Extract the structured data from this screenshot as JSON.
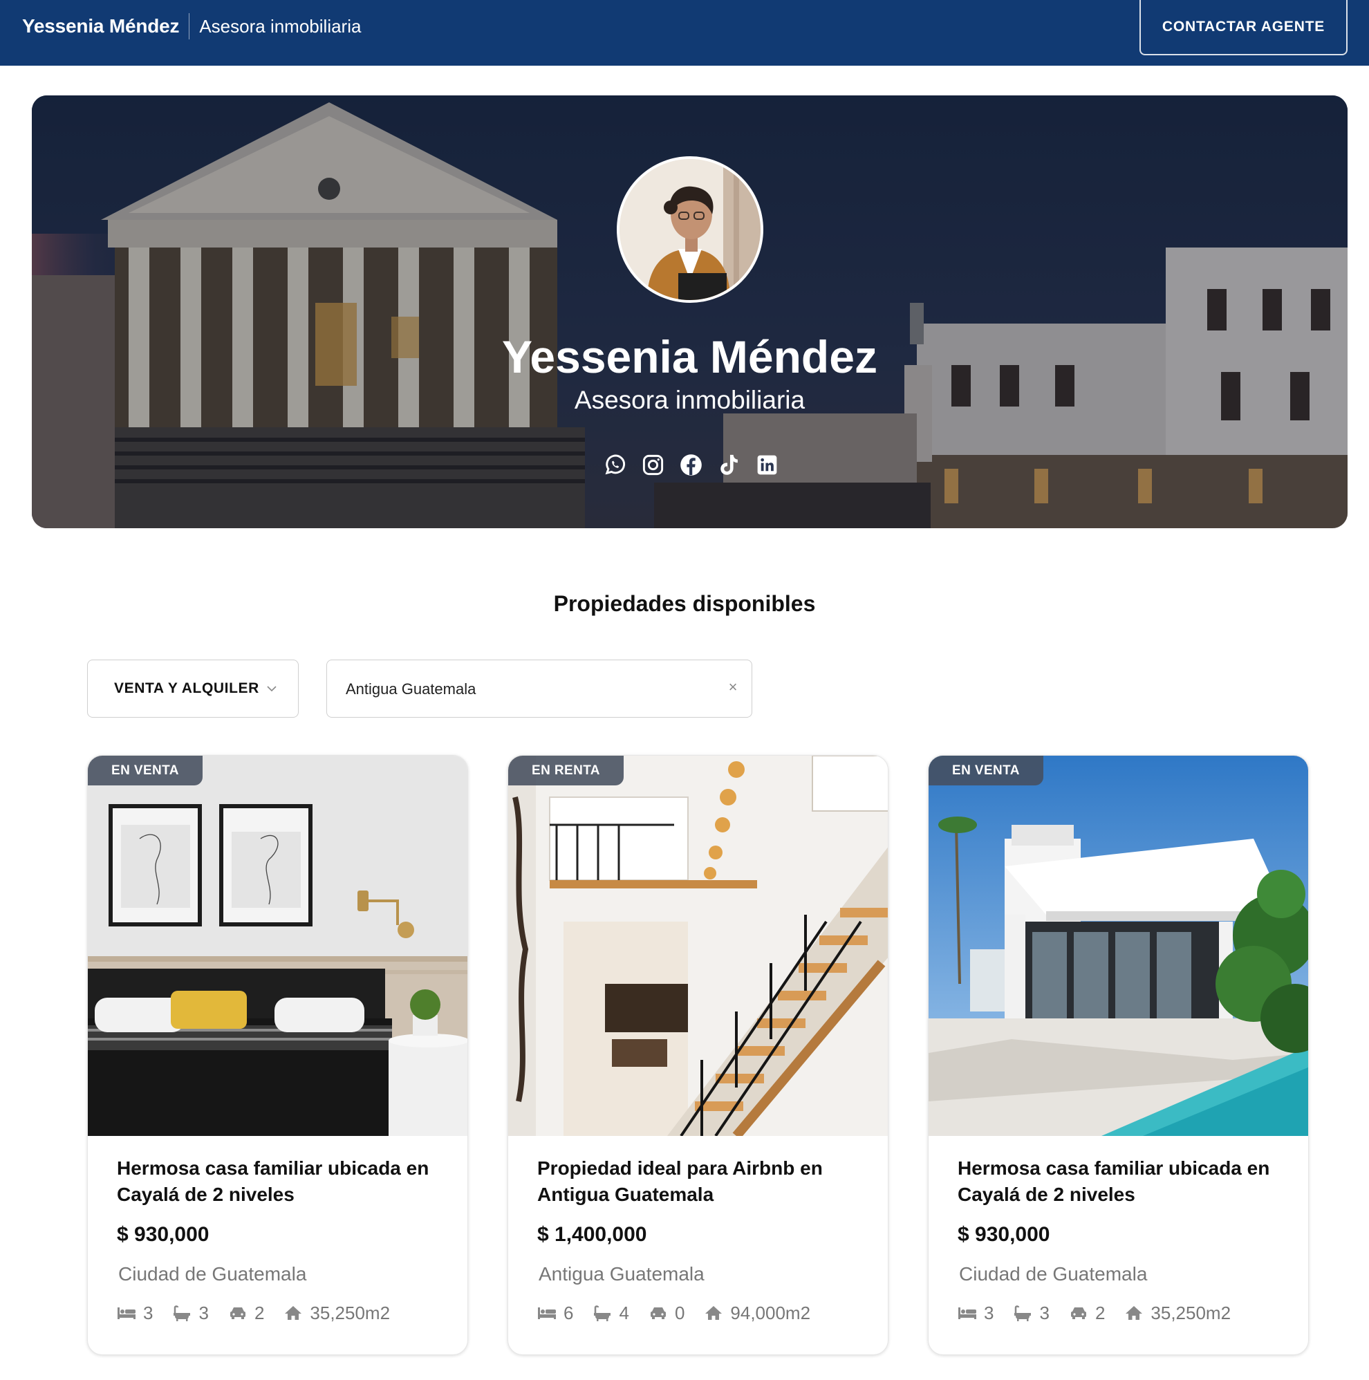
{
  "header": {
    "brand_name": "Yessenia Méndez",
    "brand_role": "Asesora inmobiliaria",
    "contact_button": "CONTACTAR AGENTE"
  },
  "hero": {
    "name": "Yessenia Méndez",
    "role": "Asesora inmobiliaria",
    "socials": [
      "whatsapp-icon",
      "instagram-icon",
      "facebook-icon",
      "tiktok-icon",
      "linkedin-icon"
    ]
  },
  "listings": {
    "title": "Propiedades disponibles",
    "filter_type": "VENTA Y ALQUILER",
    "location_value": "Antigua Guatemala",
    "clear_symbol": "×",
    "cards": [
      {
        "badge": "EN VENTA",
        "title": "Hermosa casa familiar ubicada en Cayalá de 2 niveles",
        "price": "$ 930,000",
        "location": "Ciudad de Guatemala",
        "beds": "3",
        "baths": "3",
        "parking": "2",
        "area": "35,250m2"
      },
      {
        "badge": "EN RENTA",
        "title": "Propiedad ideal para Airbnb en Antigua Guatemala",
        "price": "$ 1,400,000",
        "location": "Antigua Guatemala",
        "beds": "6",
        "baths": "4",
        "parking": "0",
        "area": "94,000m2"
      },
      {
        "badge": "EN VENTA",
        "title": "Hermosa casa familiar ubicada en Cayalá de 2 niveles",
        "price": "$ 930,000",
        "location": "Ciudad de Guatemala",
        "beds": "3",
        "baths": "3",
        "parking": "2",
        "area": "35,250m2"
      }
    ]
  },
  "colors": {
    "header_bg": "#113a73",
    "badge_bg": "#464e5f",
    "muted_text": "#777777"
  }
}
